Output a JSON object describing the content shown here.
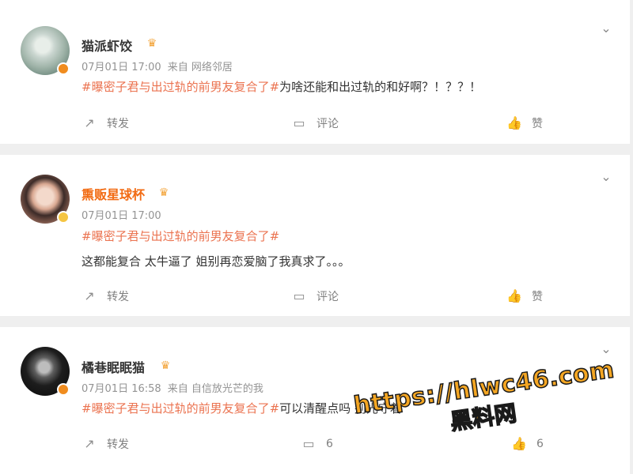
{
  "posts": [
    {
      "author": "猫派虾饺",
      "name_color": "#333333",
      "badge": "crown-icon",
      "verify_badge_color": "#f08c1e",
      "date": "07月01日 17:00",
      "source": "来自 网络邻居",
      "topic": "#曝密子君与出过轨的前男友复合了#",
      "text": "为啥还能和出过轨的和好啊？！？？！",
      "share_label": "转发",
      "comment_label": "评论",
      "like_label": "赞"
    },
    {
      "author": "熏贩星球杯",
      "name_color": "#f26b13",
      "badge": "crown-icon",
      "verify_badge_color": "#f5c542",
      "date": "07月01日 17:00",
      "source": "",
      "topic": "#曝密子君与出过轨的前男友复合了#",
      "text": "这都能复合 太牛逼了 姐别再恋爱脑了我真求了。。。",
      "share_label": "转发",
      "comment_label": "评论",
      "like_label": "赞"
    },
    {
      "author": "橘巷眠眠猫",
      "name_color": "#333333",
      "badge": "crown-icon",
      "verify_badge_color": "#f08c1e",
      "date": "07月01日 16:58",
      "source": "来自 自信放光芒的我",
      "topic": "#曝密子君与出过轨的前男友复合了#",
      "text": "可以清醒点吗 别光守着",
      "share_label": "转发",
      "comment_label": "6",
      "like_label": "6"
    }
  ],
  "watermark": {
    "url": "https://hlwc46.com",
    "sub": "黑料网"
  },
  "icons": {
    "more": "chevron-down-icon",
    "share": "share-icon",
    "comment": "comment-icon",
    "like": "thumbs-up-icon"
  },
  "colors": {
    "topic": "#eb7350",
    "meta": "#939393",
    "background": "#efefef"
  }
}
